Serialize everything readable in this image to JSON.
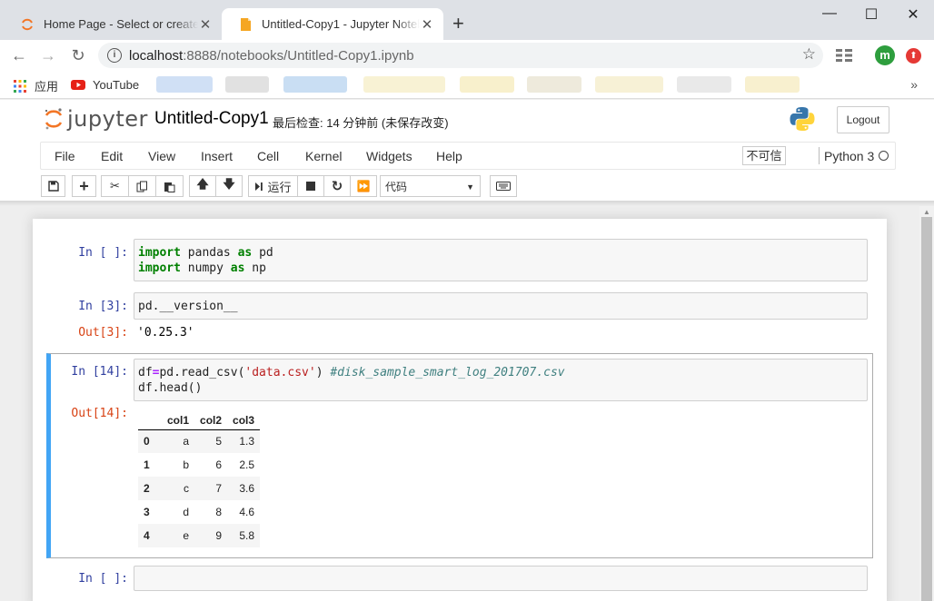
{
  "browser": {
    "tabs": [
      {
        "title": "Home Page - Select or create a notebook",
        "active": false
      },
      {
        "title": "Untitled-Copy1 - Jupyter Notebook",
        "active": true
      }
    ],
    "url_host": "localhost",
    "url_path": ":8888/notebooks/Untitled-Copy1.ipynb",
    "avatar_letter": "m",
    "bookmarks": [
      {
        "label": "应用",
        "icon": "apps-grid-icon"
      },
      {
        "label": "YouTube",
        "icon": "youtube-icon"
      }
    ]
  },
  "jupyter": {
    "logo_text": "jupyter",
    "notebook_title": "Untitled-Copy1",
    "checkpoint": "最后检查: 14 分钟前 (未保存改变)",
    "logout_label": "Logout",
    "menu": [
      "File",
      "Edit",
      "View",
      "Insert",
      "Cell",
      "Kernel",
      "Widgets",
      "Help"
    ],
    "trusted_label": "不可信",
    "kernel_name": "Python 3",
    "run_label": "运行",
    "cell_type": "代码"
  },
  "cells": [
    {
      "prompt": "In  [ ]:",
      "lines": [
        [
          {
            "t": "kw",
            "v": "import"
          },
          {
            "t": "",
            "v": " pandas "
          },
          {
            "t": "kw",
            "v": "as"
          },
          {
            "t": "",
            "v": " pd"
          }
        ],
        [
          {
            "t": "kw",
            "v": "import"
          },
          {
            "t": "",
            "v": " numpy "
          },
          {
            "t": "kw",
            "v": "as"
          },
          {
            "t": "",
            "v": " np"
          }
        ]
      ]
    },
    {
      "prompt": "In  [3]:",
      "lines": [
        [
          {
            "t": "",
            "v": "pd.__version__"
          }
        ]
      ],
      "out_prompt": "Out[3]:",
      "out_text": "'0.25.3'"
    },
    {
      "prompt": "In  [14]:",
      "lines": [
        [
          {
            "t": "",
            "v": "df"
          },
          {
            "t": "op",
            "v": "="
          },
          {
            "t": "",
            "v": "pd.read_csv("
          },
          {
            "t": "str",
            "v": "'data.csv'"
          },
          {
            "t": "",
            "v": ") "
          },
          {
            "t": "cm",
            "v": "#disk_sample_smart_log_201707.csv"
          }
        ],
        [
          {
            "t": "",
            "v": "df.head()"
          }
        ]
      ],
      "out_prompt": "Out[14]:"
    },
    {
      "prompt": "In  [ ]:",
      "lines": [
        [
          {
            "t": "",
            "v": ""
          }
        ]
      ]
    }
  ],
  "dataframe": {
    "columns": [
      "col1",
      "col2",
      "col3"
    ],
    "index": [
      "0",
      "1",
      "2",
      "3",
      "4"
    ],
    "rows": [
      [
        "a",
        "5",
        "1.3"
      ],
      [
        "b",
        "6",
        "2.5"
      ],
      [
        "c",
        "7",
        "3.6"
      ],
      [
        "d",
        "8",
        "4.6"
      ],
      [
        "e",
        "9",
        "5.8"
      ]
    ]
  }
}
